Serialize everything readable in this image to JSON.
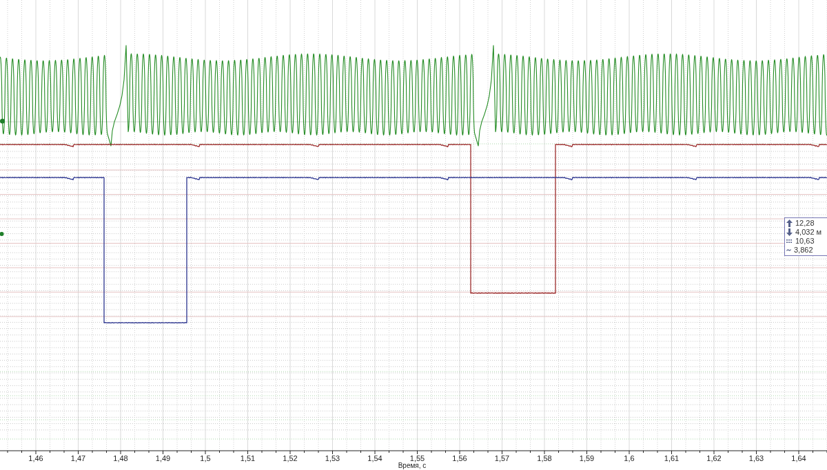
{
  "chart": {
    "traces": [
      {
        "kind": "oscillation",
        "color": "#228b22"
      },
      {
        "kind": "pulse",
        "color": "#9c2c2c"
      },
      {
        "kind": "pulse",
        "color": "#2c3590"
      }
    ],
    "x_axis": {
      "title": "Время, с",
      "tick_labels": [
        "1,46",
        "1,47",
        "1,48",
        "1,49",
        "1,5",
        "1,51",
        "1,52",
        "1,53",
        "1,54",
        "1,55",
        "1,56",
        "1,57",
        "1,58",
        "1,59",
        "1,6",
        "1,61",
        "1,62",
        "1,63",
        "1,64"
      ]
    }
  },
  "measurement_box": {
    "rows": [
      {
        "kind": "up",
        "value": "12,28"
      },
      {
        "kind": "down",
        "value": "4,032 м"
      },
      {
        "kind": "dashes",
        "value": "10,63"
      },
      {
        "kind": "wave",
        "value": "3,862"
      }
    ]
  }
}
